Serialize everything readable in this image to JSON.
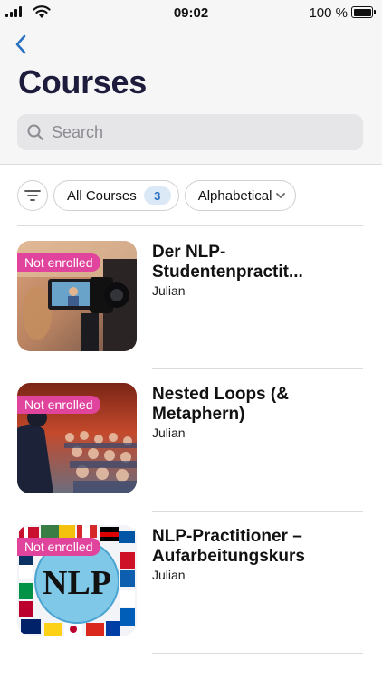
{
  "status_bar": {
    "time": "09:02",
    "battery": "100 %"
  },
  "nav": {
    "back_icon": "chevron-left-icon",
    "title": "Courses"
  },
  "search": {
    "placeholder": "Search",
    "value": ""
  },
  "filters": {
    "filter_icon": "filter-lines-icon",
    "all_label": "All Courses",
    "all_count": "3",
    "sort_label": "Alphabetical",
    "sort_icon": "chevron-down-icon"
  },
  "colors": {
    "accent": "#2a6fc0",
    "tag": "#e0449c",
    "title": "#1e1c3c"
  },
  "courses": [
    {
      "tag": "Not enrolled",
      "title": "Der NLP-Studentenpractit...",
      "author": "Julian"
    },
    {
      "tag": "Not enrolled",
      "title": "Nested Loops (& Metaphern)",
      "author": "Julian"
    },
    {
      "tag": "Not enrolled",
      "title": "NLP-Practitioner – Aufarbeitungskurs",
      "author": "Julian"
    }
  ]
}
